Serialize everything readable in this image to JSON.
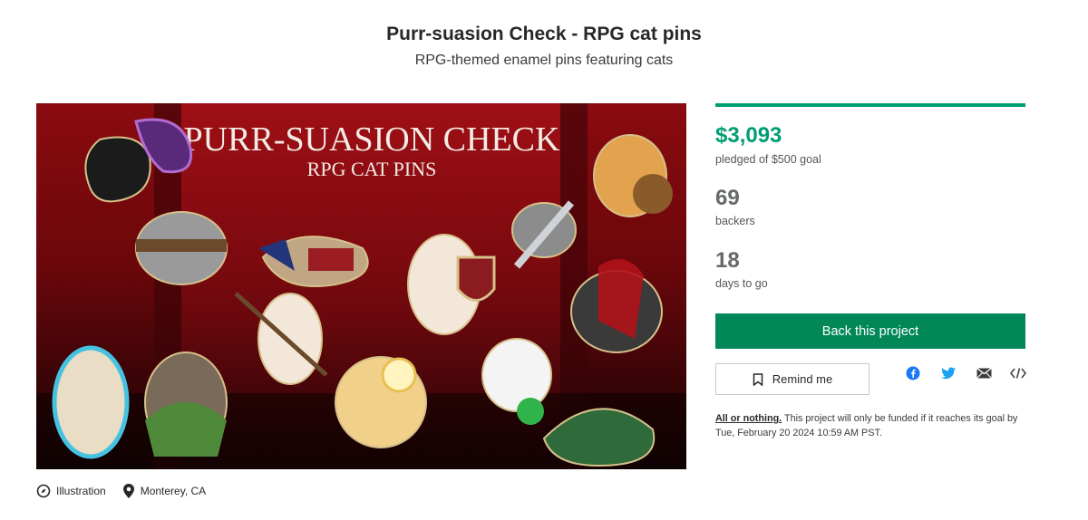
{
  "project": {
    "title": "Purr-suasion Check - RPG cat pins",
    "subtitle": "RPG-themed enamel pins featuring cats"
  },
  "hero": {
    "banner_title": "PURR-SUASION CHECK",
    "banner_subtitle": "RPG CAT PINS"
  },
  "stats": {
    "pledged": "$3,093",
    "pledged_label": "pledged of $500 goal",
    "funded_fraction": 1.0,
    "backers": "69",
    "backers_label": "backers",
    "days": "18",
    "days_label": "days to go"
  },
  "actions": {
    "back_label": "Back this project",
    "remind_label": "Remind me"
  },
  "share_icons": [
    "facebook-icon",
    "twitter-icon",
    "email-icon",
    "embed-icon"
  ],
  "fineprint": {
    "link": "All or nothing.",
    "text": " This project will only be funded if it reaches its goal by Tue, February 20 2024 10:59 AM PST."
  },
  "meta": {
    "category": "Illustration",
    "location": "Monterey, CA"
  },
  "colors": {
    "accent": "#009e74",
    "button": "#028858",
    "banner_red": "#8e0a0f",
    "banner_dark": "#1a0204"
  }
}
